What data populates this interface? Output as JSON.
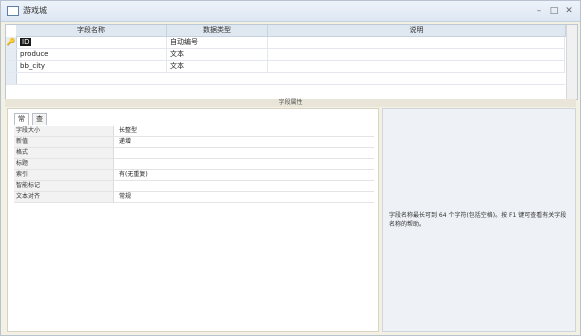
{
  "window": {
    "title": "游戏城"
  },
  "titlebar": {
    "minimize": "–",
    "maximize": "□",
    "close": "✕"
  },
  "grid": {
    "headers": [
      "字段名称",
      "数据类型",
      "说明"
    ],
    "rows": [
      {
        "name": "ID",
        "type": "自动编号",
        "desc": ""
      },
      {
        "name": "produce",
        "type": "文本",
        "desc": ""
      },
      {
        "name": "bb_city",
        "type": "文本",
        "desc": ""
      }
    ],
    "selector": "🔑"
  },
  "divider": {
    "label": "字段属性"
  },
  "tabs": [
    {
      "label": "常规"
    },
    {
      "label": "查阅"
    }
  ],
  "properties": [
    {
      "label": "字段大小",
      "value": "长整型"
    },
    {
      "label": "新值",
      "value": "递增"
    },
    {
      "label": "格式",
      "value": ""
    },
    {
      "label": "标题",
      "value": ""
    },
    {
      "label": "索引",
      "value": "有(无重复)"
    },
    {
      "label": "智能标记",
      "value": ""
    },
    {
      "label": "文本对齐",
      "value": "常规"
    }
  ],
  "help": {
    "text": "字段名称最长可到 64 个字符(包括空格)。按 F1 键可查看有关字段名称的帮助。"
  }
}
